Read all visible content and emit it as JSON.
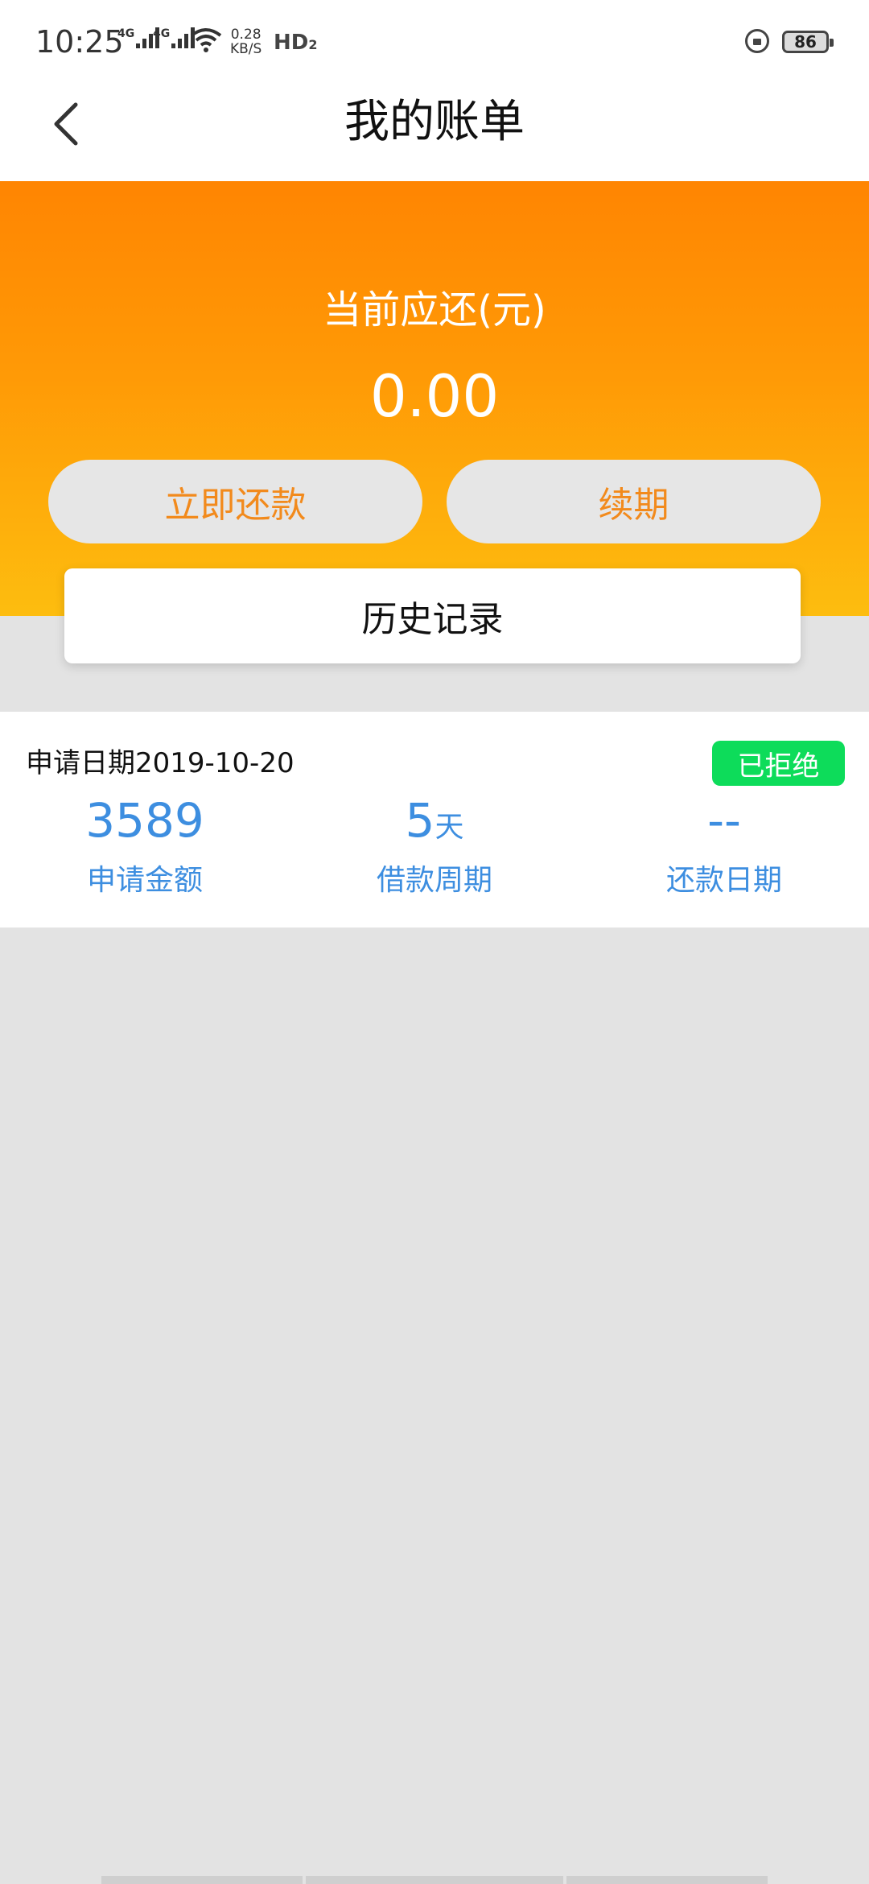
{
  "status_bar": {
    "time": "10:25",
    "network_1": "4G",
    "network_2": "4G",
    "speed_value": "0.28",
    "speed_unit": "KB/S",
    "hd_label": "HD",
    "hd_sub": "2",
    "battery": "86",
    "icons": [
      "signal-icon",
      "wifi-icon",
      "rotation-lock-icon",
      "battery-icon"
    ]
  },
  "header": {
    "title": "我的账单",
    "back_icon": "chevron-left-icon"
  },
  "summary": {
    "label": "当前应还(元)",
    "amount": "0.00",
    "repay_button": "立即还款",
    "renew_button": "续期",
    "history_button": "历史记录"
  },
  "bill": {
    "date_prefix": "申请日期",
    "date": "2019-10-20",
    "status": "已拒绝",
    "amount": "3589",
    "amount_label": "申请金额",
    "period_value": "5",
    "period_unit": "天",
    "period_label": "借款周期",
    "repay_date_value": "--",
    "repay_date_label": "还款日期"
  },
  "colors": {
    "hero_top": "#ff8502",
    "hero_bottom": "#fdbd0f",
    "accent_orange": "#f28a1c",
    "value_blue": "#3d8ee0",
    "status_green": "#0ddc5a"
  }
}
